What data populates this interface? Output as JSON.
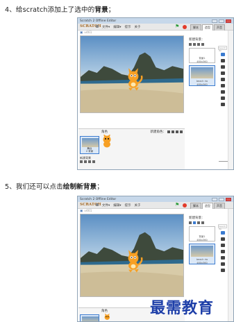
{
  "steps": {
    "step4": {
      "number": "4、",
      "text_a": "给scratch添加上了选中的",
      "text_b": "背景",
      "text_c": "；"
    },
    "step5": {
      "number": "5、",
      "text_a": "我们还可以点击",
      "text_b": "绘制新背景",
      "text_c": "；"
    }
  },
  "window": {
    "title": "Scratch 2 Offline Editor"
  },
  "menu": {
    "logo": "SCRATCH",
    "file": "文件▾",
    "edit": "编辑▾",
    "tips": "提示",
    "about": "关于"
  },
  "tabs": [
    "脚本",
    "造型",
    "声音"
  ],
  "stage": {
    "version": "v461"
  },
  "backdrops_panel": {
    "new_backdrop_label": "新建背景：",
    "search_placeholder": "Search ite",
    "blank_name": "背景1",
    "blank_size": "480x360",
    "selected_name": "beach rio",
    "selected_size": "480x360"
  },
  "sprite_pane": {
    "title": "角色",
    "new_sprite_label": "新建角色：",
    "stage_label": "舞台",
    "stage_count": "2 背景",
    "new_backdrop_label": "新建背景",
    "sprite_name": "角色1"
  },
  "watermark": "最需教育",
  "colors": {
    "accent": "#3b7bd0",
    "title_bar": "#c7d8ea",
    "stop": "#e23b2b",
    "flag": "#2a9b3a"
  }
}
